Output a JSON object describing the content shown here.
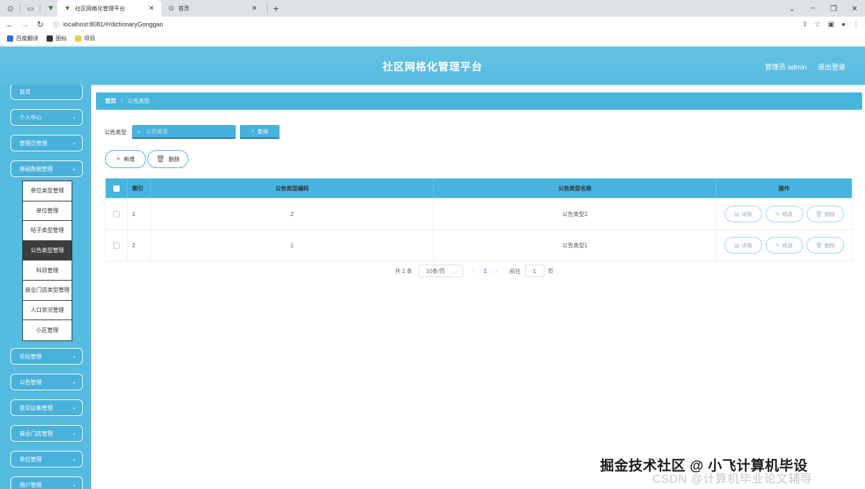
{
  "browser": {
    "tabs": [
      {
        "label": "社区网格化管理平台",
        "active": true
      },
      {
        "label": "首页",
        "active": false
      }
    ],
    "url": "localhost:8081/#/dictionaryGonggao",
    "bookmarks": [
      {
        "label": "百度翻译",
        "color": "#2b6fd6"
      },
      {
        "label": "图标",
        "color": "#333333"
      },
      {
        "label": "项目",
        "color": "#f2c94c"
      }
    ]
  },
  "header": {
    "title": "社区网格化管理平台",
    "user": "管理员 admin",
    "logout": "退出登录"
  },
  "sidebar": {
    "menus": [
      {
        "label": "首页"
      },
      {
        "label": "个人中心"
      },
      {
        "label": "管理员管理"
      },
      {
        "label": "基础数据管理"
      },
      {
        "label": "论坛管理"
      },
      {
        "label": "公告管理"
      },
      {
        "label": "意见征集管理"
      },
      {
        "label": "商业门店管理"
      },
      {
        "label": "单位管理"
      },
      {
        "label": "用户管理"
      }
    ],
    "submenu": [
      {
        "label": "单位类型管理"
      },
      {
        "label": "单位管理"
      },
      {
        "label": "帖子类型管理"
      },
      {
        "label": "公告类型管理"
      },
      {
        "label": "科目管理"
      },
      {
        "label": "商业门店类型管理"
      },
      {
        "label": "人口状况管理"
      },
      {
        "label": "小区管理"
      }
    ]
  },
  "breadcrumb": {
    "home": "首页",
    "separator": "/",
    "current": "公告类型"
  },
  "search": {
    "label": "公告类型",
    "placeholder": "公告类型",
    "button": "查询"
  },
  "actions": {
    "add": "新增",
    "delete": "删除"
  },
  "table": {
    "headers": {
      "index": "索引",
      "code": "公告类型编码",
      "name": "公告类型名称",
      "ops": "操作"
    },
    "rows": [
      {
        "index": "1",
        "code": "2",
        "name": "公告类型2"
      },
      {
        "index": "2",
        "code": "1",
        "name": "公告类型1"
      }
    ],
    "op_labels": {
      "detail": "详情",
      "edit": "修改",
      "delete": "删除"
    }
  },
  "pagination": {
    "total": "共 2 条",
    "page_size": "10条/页",
    "current_page": "1",
    "goto_label": "前往",
    "goto_value": "1",
    "page_suffix": "页"
  },
  "watermark": {
    "line1": "掘金技术社区 @ 小飞计算机毕设",
    "line2": "CSDN @计算机毕业论文辅导"
  },
  "colors": {
    "primary": "#46b4de",
    "header": "#5fc0e2",
    "active_submenu": "#3d3d3d"
  }
}
